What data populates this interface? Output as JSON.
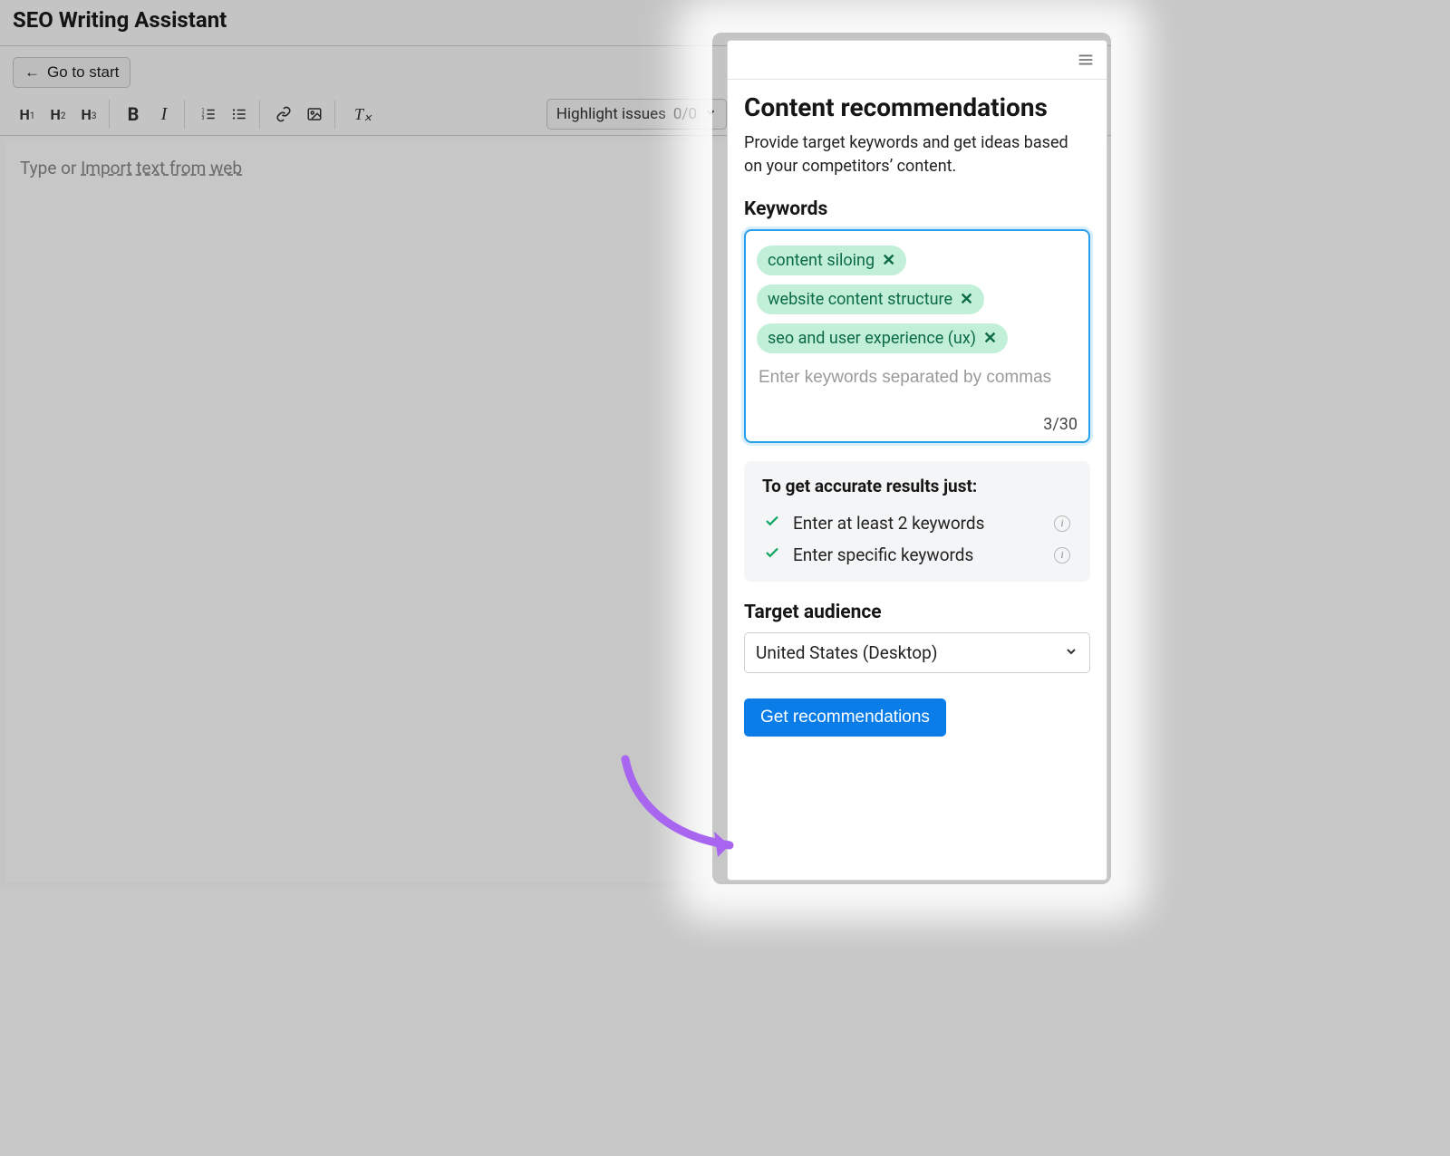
{
  "header": {
    "title": "SEO Writing Assistant"
  },
  "toolbar": {
    "go_to_start": "Go to start",
    "highlight_label": "Highlight issues",
    "highlight_count": "0/0"
  },
  "editor": {
    "placeholder_prefix": "Type or ",
    "placeholder_link": "Import text from web"
  },
  "panel": {
    "title": "Content recommendations",
    "desc": "Provide target keywords and get ideas based on your competitors’ content.",
    "keywords_heading": "Keywords",
    "chips": [
      "content siloing",
      "website content structure",
      "seo and user experience (ux)"
    ],
    "kw_placeholder": "Enter keywords separated by commas",
    "kw_count": "3/30",
    "tips_title": "To get accurate results just:",
    "tips": [
      "Enter at least 2 keywords",
      "Enter specific keywords"
    ],
    "audience_heading": "Target audience",
    "audience_value": "United States (Desktop)",
    "cta": "Get recommendations"
  }
}
